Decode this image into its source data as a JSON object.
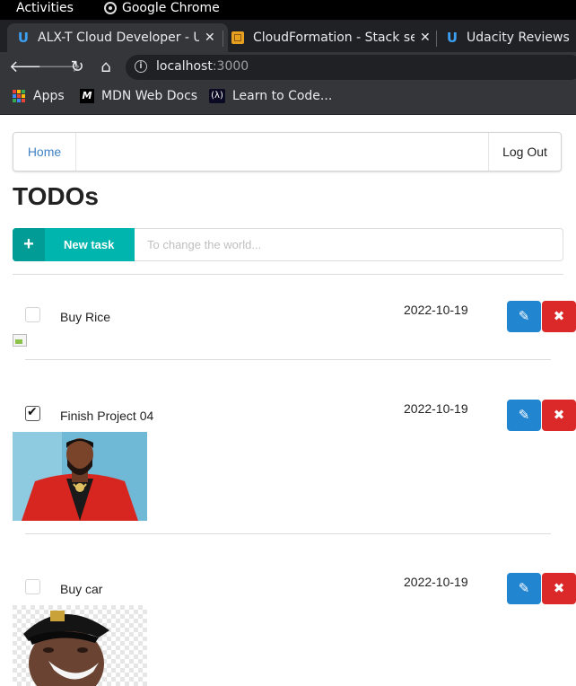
{
  "system_bar": {
    "activities": "Activities",
    "app_name": "Google Chrome"
  },
  "tabs": [
    {
      "title": "ALX-T Cloud Developer - U",
      "icon": "udacity-icon",
      "active": true
    },
    {
      "title": "CloudFormation - Stack se",
      "icon": "aws-icon",
      "active": false
    },
    {
      "title": "Udacity Reviews",
      "icon": "udacity-icon",
      "active": false
    }
  ],
  "toolbar": {
    "url_host": "localhost",
    "url_port": ":3000"
  },
  "bookmarks": [
    {
      "label": "Apps",
      "icon": "apps-grid-icon"
    },
    {
      "label": "MDN Web Docs",
      "icon": "mdn-icon"
    },
    {
      "label": "Learn to Code...",
      "icon": "freecodecamp-icon"
    }
  ],
  "app": {
    "nav": {
      "home": "Home",
      "logout": "Log Out"
    },
    "title": "TODOs",
    "new_task": {
      "label": "New task",
      "placeholder": "To change the world...",
      "value": ""
    },
    "todos": [
      {
        "name": "Buy Rice",
        "date": "2022-10-19",
        "done": false,
        "image": "broken"
      },
      {
        "name": "Finish Project 04",
        "date": "2022-10-19",
        "done": true,
        "image": "photo-man-red-jacket"
      },
      {
        "name": "Buy car",
        "date": "2022-10-19",
        "done": false,
        "image": "photo-man-black-cap"
      }
    ]
  },
  "colors": {
    "new_task_button": "#00b5ad",
    "edit_button": "#2185d0",
    "delete_button": "#db2828",
    "link": "#4183c4"
  }
}
